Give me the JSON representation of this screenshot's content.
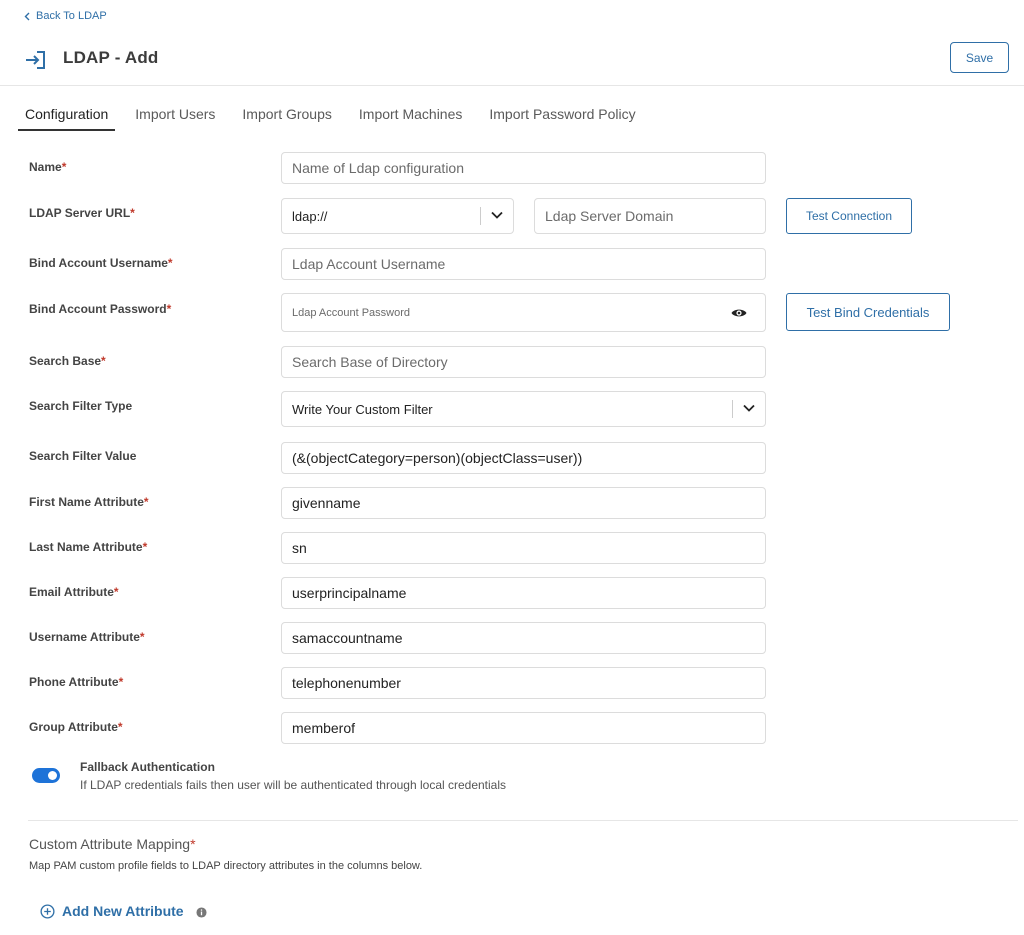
{
  "nav": {
    "back_label": "Back To LDAP"
  },
  "header": {
    "title": "LDAP - Add",
    "save_label": "Save"
  },
  "tabs": [
    {
      "label": "Configuration",
      "active": true
    },
    {
      "label": "Import Users"
    },
    {
      "label": "Import Groups"
    },
    {
      "label": "Import Machines"
    },
    {
      "label": "Import Password Policy"
    }
  ],
  "form": {
    "name": {
      "label": "Name",
      "placeholder": "Name of Ldap configuration"
    },
    "server_url": {
      "label": "LDAP Server URL",
      "protocol": "ldap://",
      "domain_placeholder": "Ldap Server Domain",
      "test_label": "Test Connection"
    },
    "bind_username": {
      "label": "Bind Account Username",
      "placeholder": "Ldap Account Username"
    },
    "bind_password": {
      "label": "Bind Account Password",
      "placeholder": "Ldap Account Password",
      "test_label": "Test Bind Credentials"
    },
    "search_base": {
      "label": "Search Base",
      "placeholder": "Search Base of Directory"
    },
    "search_filter_type": {
      "label": "Search Filter Type",
      "value": "Write Your Custom Filter"
    },
    "search_filter_value": {
      "label": "Search Filter Value",
      "value": "(&(objectCategory=person)(objectClass=user))"
    },
    "first_name_attr": {
      "label": "First Name Attribute",
      "value": "givenname"
    },
    "last_name_attr": {
      "label": "Last Name Attribute",
      "value": "sn"
    },
    "email_attr": {
      "label": "Email Attribute",
      "value": "userprincipalname"
    },
    "username_attr": {
      "label": "Username Attribute",
      "value": "samaccountname"
    },
    "phone_attr": {
      "label": "Phone Attribute",
      "value": "telephonenumber"
    },
    "group_attr": {
      "label": "Group Attribute",
      "value": "memberof"
    },
    "required_marker": "*"
  },
  "fallback": {
    "title": "Fallback Authentication",
    "description": "If LDAP credentials fails then user will be authenticated through local credentials",
    "enabled": true
  },
  "custom_mapping": {
    "title": "Custom Attribute Mapping",
    "description": "Map PAM custom profile fields to LDAP directory attributes in the columns below.",
    "add_label": "Add New Attribute"
  },
  "colors": {
    "accent": "#2f6fa7",
    "toggle": "#1e73d8",
    "required": "#c0392b"
  },
  "icons": [
    "chevron-left-icon",
    "login-arrow-icon",
    "chevron-down-icon",
    "eye-icon",
    "plus-circle-icon",
    "info-icon"
  ]
}
